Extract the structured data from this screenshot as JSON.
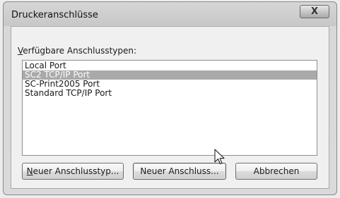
{
  "window": {
    "title": "Druckeranschlüsse",
    "close_glyph": "X"
  },
  "group": {
    "label_mnemonic": "V",
    "label_rest": "erfügbare Anschlusstypen:"
  },
  "port_list": {
    "items": [
      {
        "label": "Local Port",
        "selected": false
      },
      {
        "label": "SC2 TCP/IP Port",
        "selected": true
      },
      {
        "label": "SC-Print2005 Port",
        "selected": false
      },
      {
        "label": "Standard TCP/IP Port",
        "selected": false
      }
    ]
  },
  "buttons": {
    "new_type_mnemonic": "N",
    "new_type_rest": "euer Anschlusstyp...",
    "new_port_label": "Neuer Anschluss...",
    "cancel_label": "Abbrechen"
  },
  "colors": {
    "selection": "#a9a9a9",
    "frame": "#d6d6d6"
  },
  "icons": {
    "cursor": "arrow-cursor-icon",
    "close": "close-icon"
  }
}
